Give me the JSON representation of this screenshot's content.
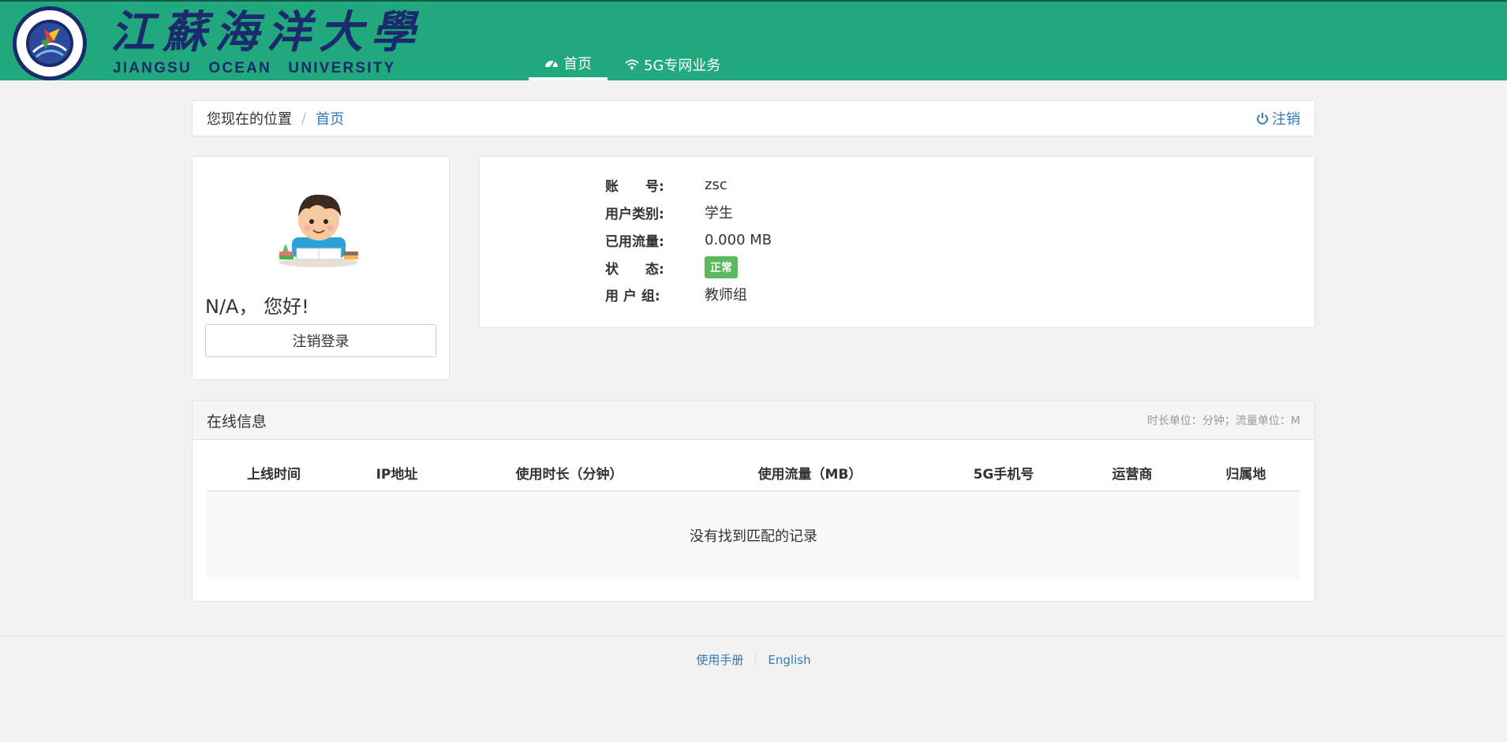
{
  "header": {
    "logo_title": "江蘇海洋大學",
    "logo_subtitle": "JIANGSU OCEAN UNIVERSITY",
    "nav": [
      {
        "label": "首页",
        "icon": "dashboard-icon",
        "active": true
      },
      {
        "label": "5G专网业务",
        "icon": "wifi-icon",
        "active": false
      }
    ],
    "brand_color": "#21a87c"
  },
  "breadcrumb": {
    "location_label": "您现在的位置",
    "separator": "/",
    "current": "首页",
    "logout_label": "注销"
  },
  "user": {
    "greeting": "N/A， 您好!",
    "logout_button": "注销登录"
  },
  "info": {
    "account_label": "账　　号:",
    "account_value": "zsc",
    "user_type_label": "用户类别:",
    "user_type_value": "学生",
    "used_traffic_label": "已用流量:",
    "used_traffic_value": "0.000 MB",
    "status_label": "状　　态:",
    "status_value": "正常",
    "status_color": "#5cb85c",
    "group_label": "用 户 组:",
    "group_value": "教师组"
  },
  "online": {
    "title": "在线信息",
    "units": "时长单位：分钟；流量单位：M",
    "columns": [
      "上线时间",
      "IP地址",
      "使用时长（分钟）",
      "使用流量（MB）",
      "5G手机号",
      "运营商",
      "归属地"
    ],
    "empty_text": "没有找到匹配的记录"
  },
  "footer": {
    "manual": "使用手册",
    "english": "English"
  }
}
